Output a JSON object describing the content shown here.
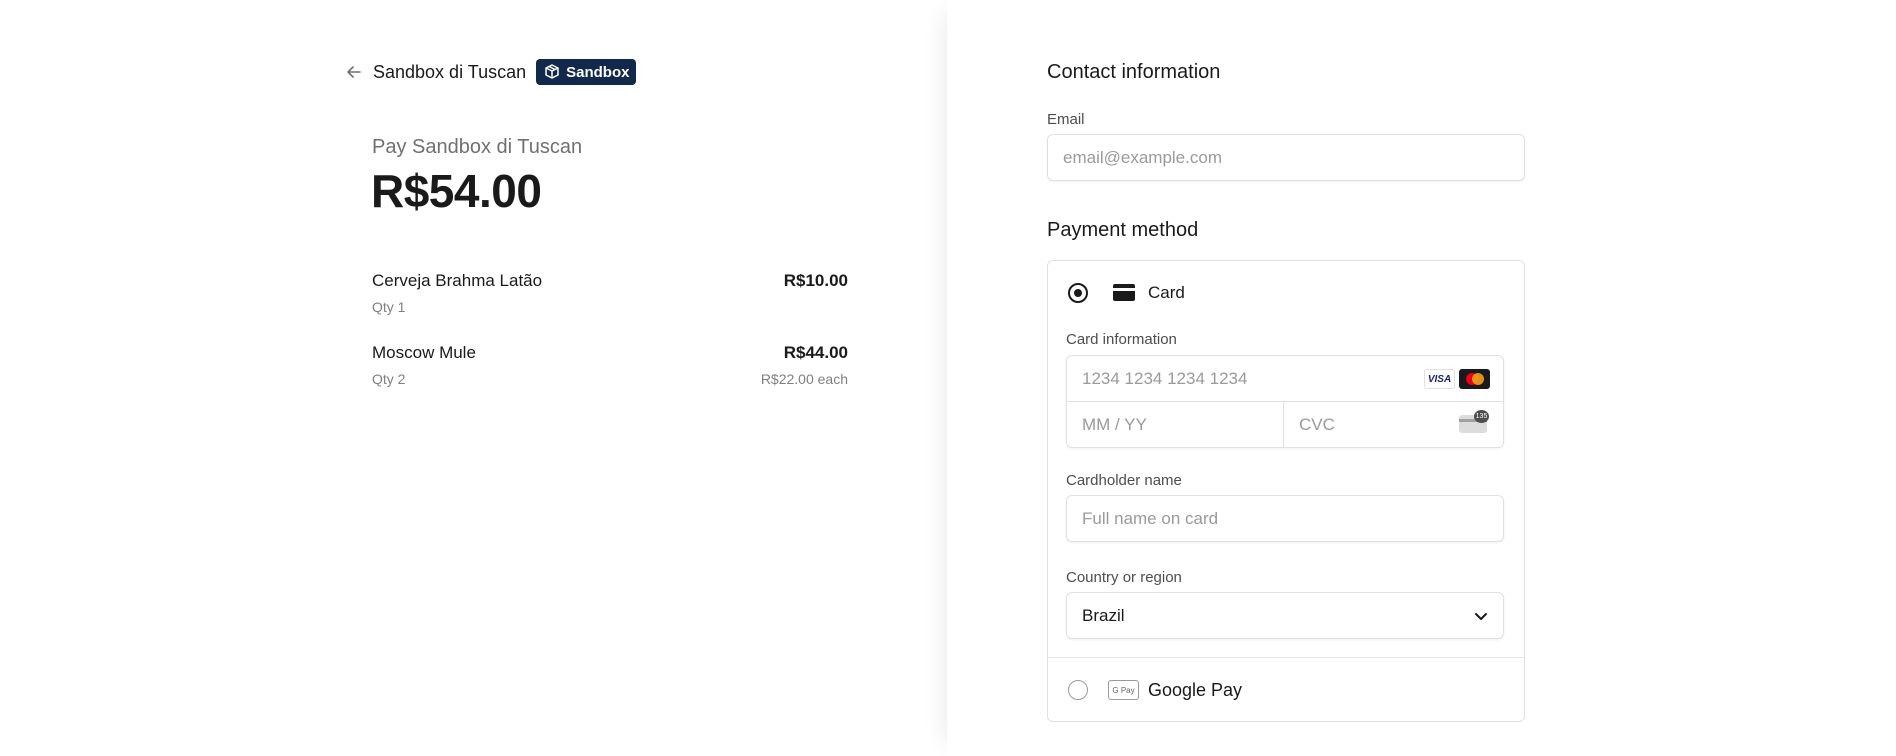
{
  "header": {
    "merchant": "Sandbox di Tuscan",
    "badge": "Sandbox"
  },
  "summary": {
    "pay_label": "Pay Sandbox di Tuscan",
    "amount": "R$54.00",
    "items": [
      {
        "name": "Cerveja Brahma Latão",
        "price": "R$10.00",
        "qty": "Qty 1",
        "each": ""
      },
      {
        "name": "Moscow Mule",
        "price": "R$44.00",
        "qty": "Qty 2",
        "each": "R$22.00 each"
      }
    ]
  },
  "contact": {
    "title": "Contact information",
    "email_label": "Email",
    "email_placeholder": "email@example.com"
  },
  "payment": {
    "title": "Payment method",
    "card_option": "Card",
    "card_info_label": "Card information",
    "card_number_placeholder": "1234 1234 1234 1234",
    "expiry_placeholder": "MM / YY",
    "cvc_placeholder": "CVC",
    "brands": [
      "VISA",
      "Mastercard"
    ],
    "cvc_badge": "135",
    "cardholder_label": "Cardholder name",
    "cardholder_placeholder": "Full name on card",
    "country_label": "Country or region",
    "country_value": "Brazil",
    "gpay_option": "Google Pay",
    "gpay_logo": "G Pay"
  },
  "colors": {
    "badge_bg": "#13294b",
    "visa_blue": "#1a1f71",
    "mc_red": "#eb001b",
    "mc_orange": "#f79e1b"
  }
}
